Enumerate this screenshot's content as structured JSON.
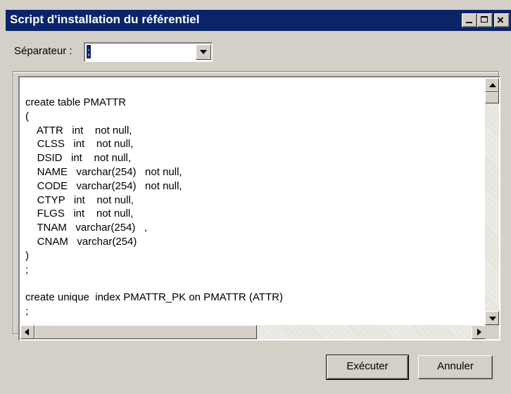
{
  "window": {
    "title": "Script d'installation du référentiel",
    "controls": {
      "minimize": "_",
      "maximize": "□",
      "close": "✕"
    }
  },
  "separator": {
    "label": "Séparateur :",
    "value": ";"
  },
  "script": {
    "lines": [
      "create table PMATTR",
      "(",
      "    ATTR   int    not null,",
      "    CLSS   int    not null,",
      "    DSID   int    not null,",
      "    NAME   varchar(254)   not null,",
      "    CODE   varchar(254)   not null,",
      "    CTYP   int    not null,",
      "    FLGS   int    not null,",
      "    TNAM   varchar(254)   ,",
      "    CNAM   varchar(254)",
      ")",
      ";",
      "",
      "create unique  index PMATTR_PK on PMATTR (ATTR)",
      ";"
    ]
  },
  "buttons": {
    "execute": "Exécuter",
    "cancel": "Annuler"
  }
}
